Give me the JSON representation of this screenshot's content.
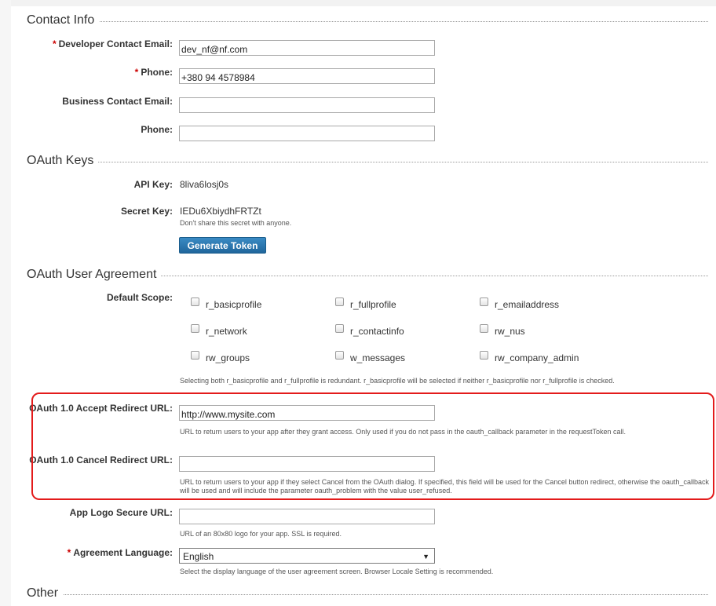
{
  "contact": {
    "title": "Contact Info",
    "dev_email_label": "Developer Contact Email:",
    "dev_email_value": "dev_nf@nf.com",
    "phone_label": "Phone:",
    "phone_value": "+380 94 4578984",
    "business_email_label": "Business Contact Email:",
    "business_email_value": "",
    "phone2_label": "Phone:",
    "phone2_value": "",
    "required_mark": "*"
  },
  "oauth_keys": {
    "title": "OAuth Keys",
    "api_key_label": "API Key:",
    "api_key_value": "8liva6losj0s",
    "secret_key_label": "Secret Key:",
    "secret_key_value": "IEDu6XbiydhFRTZt",
    "secret_hint": "Don't share this secret with anyone.",
    "generate_button": "Generate Token"
  },
  "agreement": {
    "title": "OAuth User Agreement",
    "scope_label": "Default Scope:",
    "scopes": [
      {
        "label": "r_basicprofile",
        "checked": false
      },
      {
        "label": "r_fullprofile",
        "checked": false
      },
      {
        "label": "r_emailaddress",
        "checked": false
      },
      {
        "label": "r_network",
        "checked": false
      },
      {
        "label": "r_contactinfo",
        "checked": false
      },
      {
        "label": "rw_nus",
        "checked": false
      },
      {
        "label": "rw_groups",
        "checked": false
      },
      {
        "label": "w_messages",
        "checked": false
      },
      {
        "label": "rw_company_admin",
        "checked": false
      }
    ],
    "scope_hint": "Selecting both r_basicprofile and r_fullprofile is redundant. r_basicprofile will be selected if neither r_basicprofile nor r_fullprofile is checked.",
    "accept_label": "OAuth 1.0 Accept Redirect URL:",
    "accept_value": "http://www.mysite.com",
    "accept_hint": "URL to return users to your app after they grant access. Only used if you do not pass in the oauth_callback parameter in the requestToken call.",
    "cancel_label": "OAuth 1.0 Cancel Redirect URL:",
    "cancel_value": "",
    "cancel_hint": "URL to return users to your app if they select Cancel from the OAuth dialog. If specified, this field will be used for the Cancel button redirect, otherwise the oauth_callback will be used and will include the parameter oauth_problem with the value user_refused.",
    "logo_label": "App Logo Secure URL:",
    "logo_value": "",
    "logo_hint": "URL of an 80x80 logo for your app. SSL is required.",
    "language_label": "Agreement Language:",
    "language_value": "English",
    "language_hint": "Select the display language of the user agreement screen. Browser Locale Setting is recommended."
  },
  "other": {
    "title": "Other"
  },
  "colors": {
    "required": "#cc0000",
    "highlight": "#e31b1b",
    "button": "#2a73ad"
  },
  "icons": {
    "select_arrow": "dropdown-arrow-icon"
  }
}
